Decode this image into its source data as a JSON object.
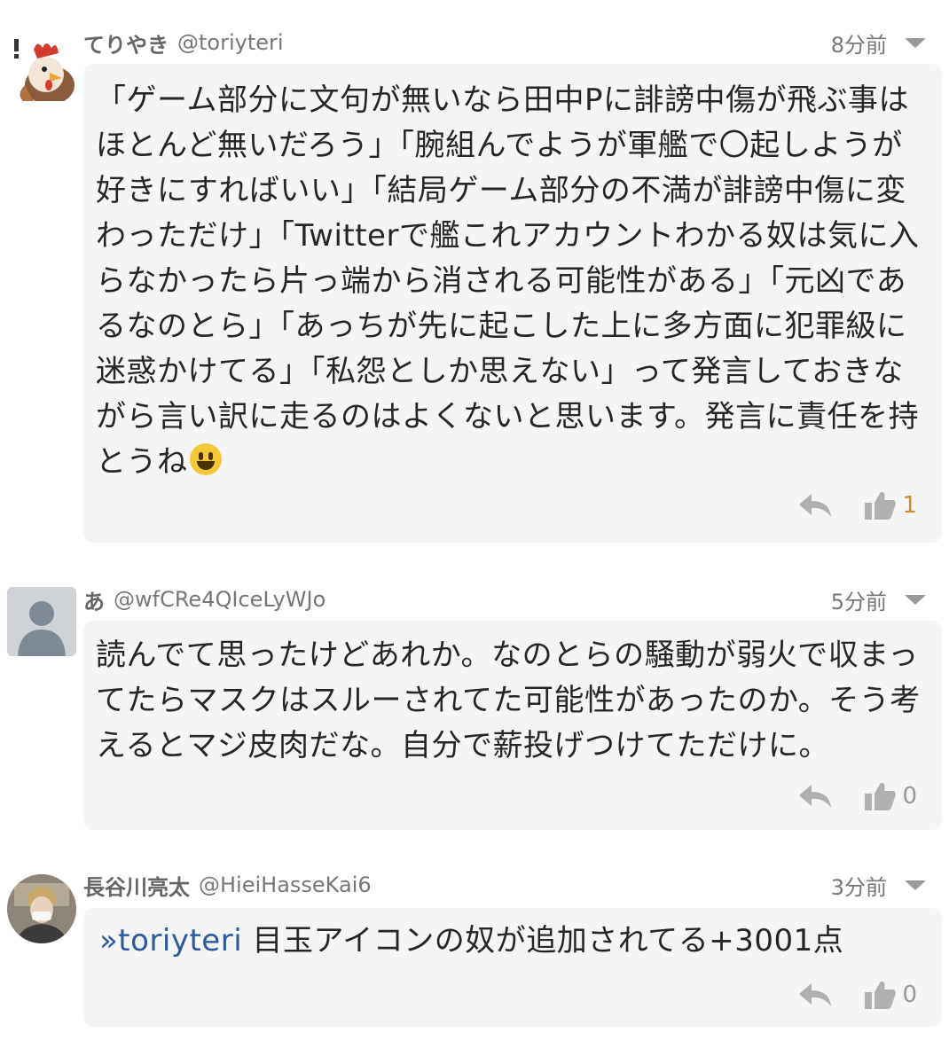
{
  "comments": [
    {
      "name": "てりやき",
      "handle": "@toriyteri",
      "time": "8分前",
      "text": "「ゲーム部分に文句が無いなら田中Pに誹謗中傷が飛ぶ事はほとんど無いだろう」「腕組んでようが軍艦で〇起しようが好きにすればいい」「結局ゲーム部分の不満が誹謗中傷に変わっただけ」「Twitterで艦これアカウントわかる奴は気に入らなかったら片っ端から消される可能性がある」「元凶であるなのとら」「あっちが先に起こした上に多方面に犯罪級に迷惑かけてる」「私怨としか思えない」って発言しておきながら言い訳に走るのはよくないと思います。発言に責任を持とうね",
      "emoji": "grinning-face-emoji",
      "likes": "1",
      "avatar": "chicken-avatar",
      "accent": "#d08a2c"
    },
    {
      "name": "あ",
      "handle": "@wfCRe4QIceLyWJo",
      "time": "5分前",
      "text": "読んでて思ったけどあれか。なのとらの騒動が弱火で収まってたらマスクはスルーされてた可能性があったのか。そう考えるとマジ皮肉だな。自分で薪投げつけてただけに。",
      "likes": "0",
      "avatar": "default-user-avatar"
    },
    {
      "name": "長谷川亮太",
      "handle": "@HieiHasseKai6",
      "time": "3分前",
      "mention": "»toriyteri",
      "text": " 目玉アイコンの奴が追加されてる+3001点",
      "likes": "0",
      "avatar": "photo-avatar",
      "mention_color": "#2c5aa0"
    }
  ]
}
